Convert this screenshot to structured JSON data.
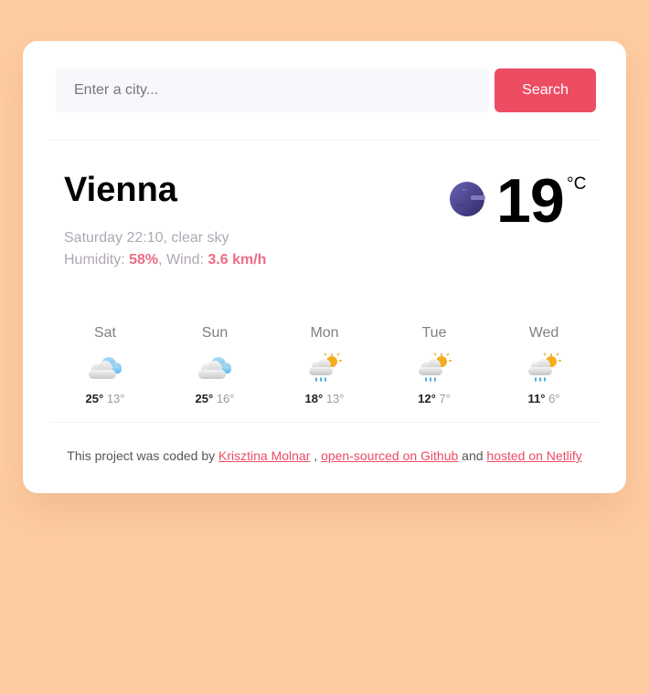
{
  "search": {
    "placeholder": "Enter a city...",
    "button_label": "Search"
  },
  "current": {
    "city": "Vienna",
    "description": "Saturday 22:10, clear sky",
    "humidity_label": "Humidity: ",
    "humidity_value": "58%",
    "wind_label": ", Wind: ",
    "wind_value": "3.6 km/h",
    "temperature": "19",
    "unit": "°C",
    "icon": "moon-icon"
  },
  "forecast": [
    {
      "day": "Sat",
      "max": "25°",
      "min": "13°",
      "icon": "cloudy-icon"
    },
    {
      "day": "Sun",
      "max": "25°",
      "min": "16°",
      "icon": "cloudy-icon"
    },
    {
      "day": "Mon",
      "max": "18°",
      "min": "13°",
      "icon": "rain-sun-icon"
    },
    {
      "day": "Tue",
      "max": "12°",
      "min": "7°",
      "icon": "rain-sun-icon"
    },
    {
      "day": "Wed",
      "max": "11°",
      "min": "6°",
      "icon": "rain-sun-icon"
    }
  ],
  "footer": {
    "prefix": "This project was coded by ",
    "author": "Krisztina Molnar",
    "sep1": " , ",
    "github": "open-sourced on Github",
    "sep2": " and ",
    "netlify": "hosted on Netlify"
  },
  "colors": {
    "background": "#fecca3",
    "accent": "#ec4d63",
    "highlight": "#ec6d83"
  }
}
